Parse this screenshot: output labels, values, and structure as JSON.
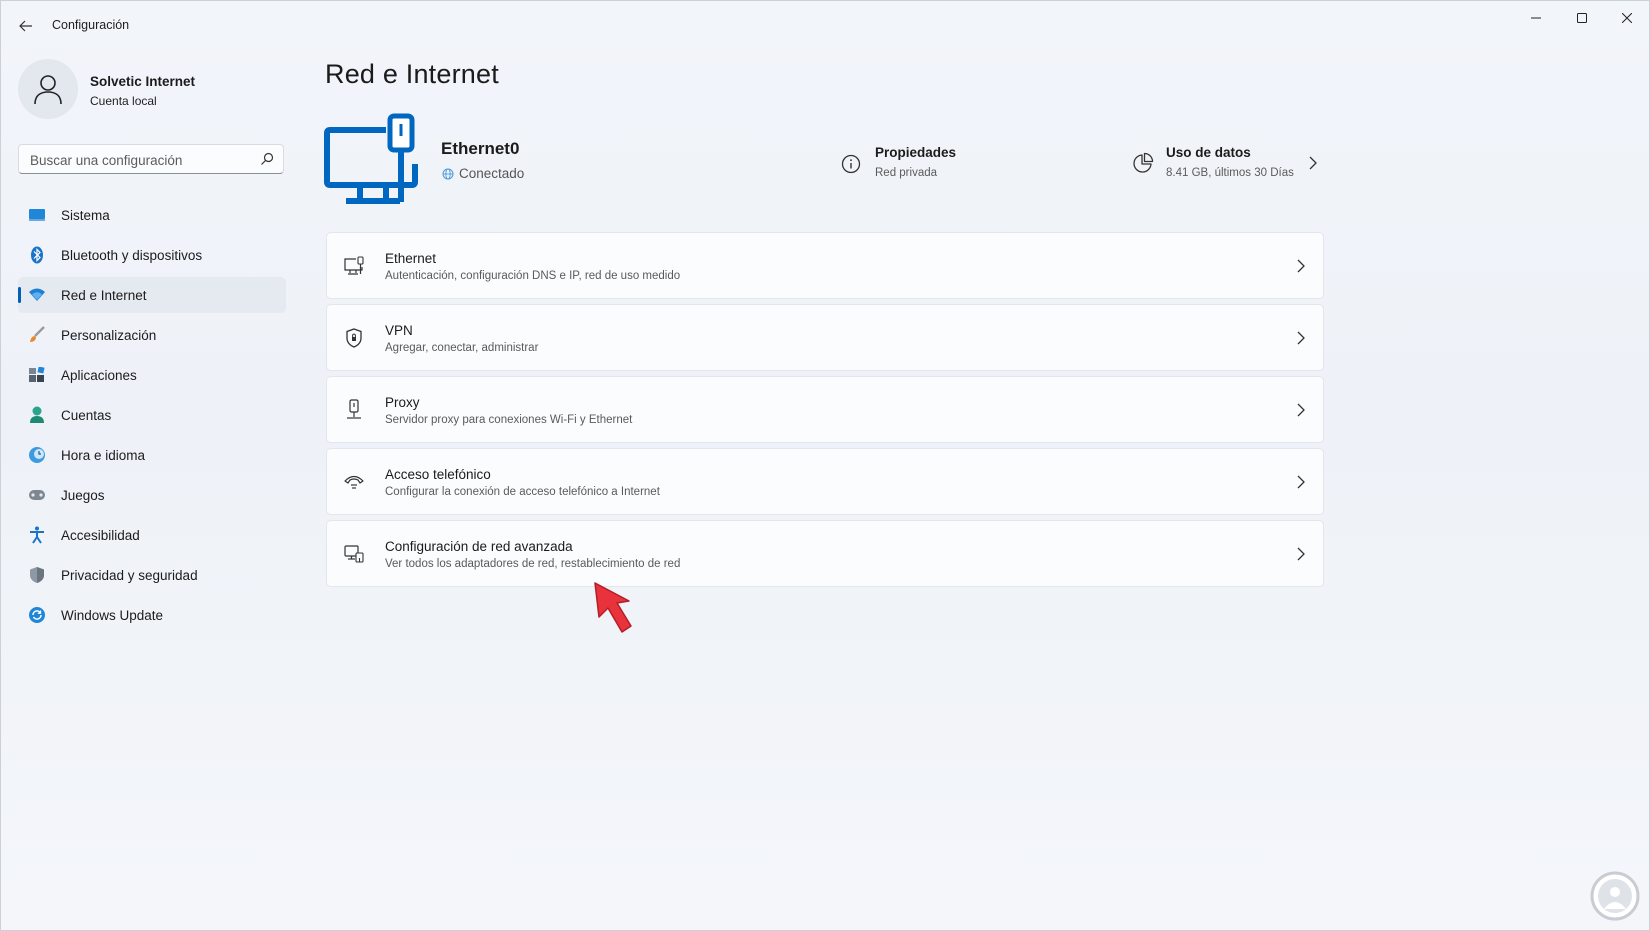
{
  "window": {
    "title": "Configuración",
    "colors": {
      "accent": "#005fb8",
      "hero_icon": "#0067c0",
      "annotation_arrow": "#e8323c"
    }
  },
  "profile": {
    "name": "Solvetic Internet",
    "account_type": "Cuenta local"
  },
  "search": {
    "placeholder": "Buscar una configuración"
  },
  "sidebar": {
    "items": [
      {
        "label": "Sistema",
        "icon": "monitor-icon",
        "active": false
      },
      {
        "label": "Bluetooth y dispositivos",
        "icon": "bluetooth-icon",
        "active": false
      },
      {
        "label": "Red e Internet",
        "icon": "wifi-icon",
        "active": true
      },
      {
        "label": "Personalización",
        "icon": "brush-icon",
        "active": false
      },
      {
        "label": "Aplicaciones",
        "icon": "apps-icon",
        "active": false
      },
      {
        "label": "Cuentas",
        "icon": "person-icon",
        "active": false
      },
      {
        "label": "Hora e idioma",
        "icon": "clock-globe-icon",
        "active": false
      },
      {
        "label": "Juegos",
        "icon": "gamepad-icon",
        "active": false
      },
      {
        "label": "Accesibilidad",
        "icon": "accessibility-icon",
        "active": false
      },
      {
        "label": "Privacidad y seguridad",
        "icon": "shield-icon",
        "active": false
      },
      {
        "label": "Windows Update",
        "icon": "update-icon",
        "active": false
      }
    ]
  },
  "main": {
    "title": "Red e Internet",
    "connection": {
      "name": "Ethernet0",
      "status": "Conectado"
    },
    "properties": {
      "title": "Propiedades",
      "subtitle": "Red privada"
    },
    "data_usage": {
      "title": "Uso de datos",
      "subtitle": "8.41 GB, últimos 30 Días"
    },
    "cards": [
      {
        "title": "Ethernet",
        "subtitle": "Autenticación, configuración DNS e IP, red de uso medido",
        "icon": "ethernet-icon"
      },
      {
        "title": "VPN",
        "subtitle": "Agregar, conectar, administrar",
        "icon": "vpn-shield-icon"
      },
      {
        "title": "Proxy",
        "subtitle": "Servidor proxy para conexiones Wi-Fi y Ethernet",
        "icon": "proxy-icon"
      },
      {
        "title": "Acceso telefónico",
        "subtitle": "Configurar la conexión de acceso telefónico a Internet",
        "icon": "dialup-phone-icon"
      },
      {
        "title": "Configuración de red avanzada",
        "subtitle": "Ver todos los adaptadores de red, restablecimiento de red",
        "icon": "network-adapter-icon"
      }
    ]
  }
}
